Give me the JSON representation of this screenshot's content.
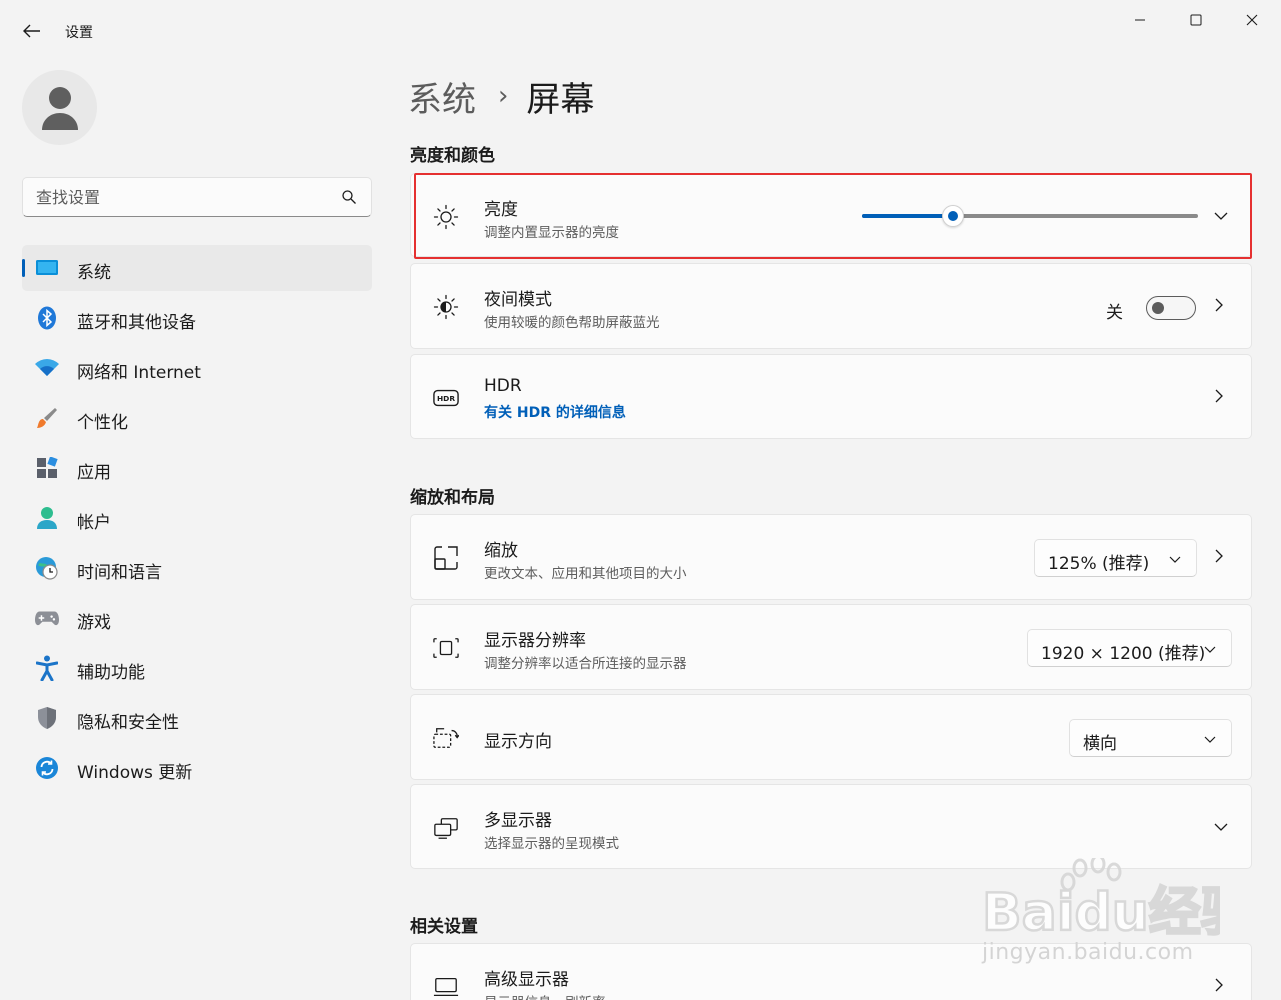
{
  "window": {
    "title": "设置"
  },
  "sidebar": {
    "search_placeholder": "查找设置",
    "items": [
      {
        "label": "系统",
        "icon": "display-icon",
        "active": true
      },
      {
        "label": "蓝牙和其他设备",
        "icon": "bluetooth-icon",
        "active": false
      },
      {
        "label": "网络和 Internet",
        "icon": "wifi-icon",
        "active": false
      },
      {
        "label": "个性化",
        "icon": "brush-icon",
        "active": false
      },
      {
        "label": "应用",
        "icon": "apps-icon",
        "active": false
      },
      {
        "label": "帐户",
        "icon": "account-icon",
        "active": false
      },
      {
        "label": "时间和语言",
        "icon": "globe-clock-icon",
        "active": false
      },
      {
        "label": "游戏",
        "icon": "gamepad-icon",
        "active": false
      },
      {
        "label": "辅助功能",
        "icon": "accessibility-icon",
        "active": false
      },
      {
        "label": "隐私和安全性",
        "icon": "shield-icon",
        "active": false
      },
      {
        "label": "Windows 更新",
        "icon": "update-icon",
        "active": false
      }
    ]
  },
  "breadcrumb": {
    "parent": "系统",
    "separator": "›",
    "current": "屏幕"
  },
  "sections": {
    "brightness_color": "亮度和颜色",
    "scale_layout": "缩放和布局",
    "related": "相关设置"
  },
  "brightness": {
    "title": "亮度",
    "subtitle": "调整内置显示器的亮度",
    "value_fraction": 0.27
  },
  "night_light": {
    "title": "夜间模式",
    "subtitle": "使用较暖的颜色帮助屏蔽蓝光",
    "state_label": "关",
    "on": false
  },
  "hdr": {
    "title": "HDR",
    "link": "有关 HDR 的详细信息"
  },
  "scale": {
    "title": "缩放",
    "subtitle": "更改文本、应用和其他项目的大小",
    "value": "125% (推荐)"
  },
  "resolution": {
    "title": "显示器分辨率",
    "subtitle": "调整分辨率以适合所连接的显示器",
    "value": "1920 × 1200 (推荐)"
  },
  "orientation": {
    "title": "显示方向",
    "value": "横向"
  },
  "multi_display": {
    "title": "多显示器",
    "subtitle": "选择显示器的呈现模式"
  },
  "advanced_display": {
    "title": "高级显示器",
    "subtitle": "显示器信息，刷新率"
  },
  "watermark": {
    "brand": "Baidu经验",
    "url": "jingyan.baidu.com"
  },
  "colors": {
    "accent": "#005fb8",
    "highlight_border": "#e53030"
  }
}
